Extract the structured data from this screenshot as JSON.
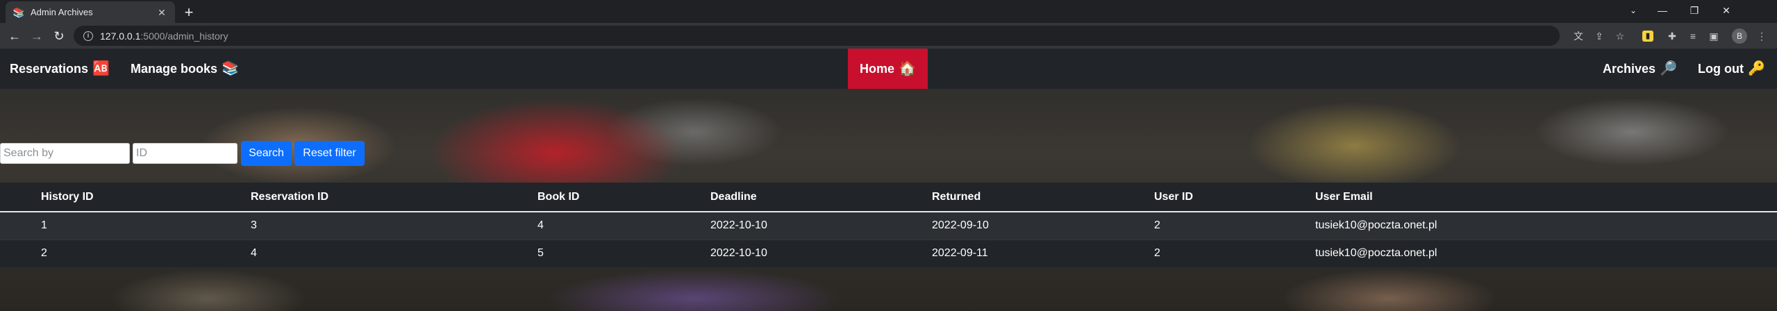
{
  "browser": {
    "tab_title": "Admin Archives",
    "tab_favicon": "📚",
    "url_host": "127.0.0.1",
    "url_path": ":5000/admin_history",
    "profile_initial": "B"
  },
  "nav": {
    "reservations": "Reservations",
    "reservations_emoji": "🆎",
    "manage_books": "Manage books",
    "manage_books_emoji": "📚",
    "home": "Home",
    "home_emoji": "🏠",
    "archives": "Archives",
    "archives_emoji": "🔎",
    "logout": "Log out",
    "logout_emoji": "🔑"
  },
  "filters": {
    "search_placeholder": "Search by",
    "id_placeholder": "ID",
    "search_button": "Search",
    "reset_button": "Reset filter"
  },
  "table": {
    "columns": [
      "History ID",
      "Reservation ID",
      "Book ID",
      "Deadline",
      "Returned",
      "User ID",
      "User Email"
    ],
    "rows": [
      [
        "1",
        "3",
        "4",
        "2022-10-10",
        "2022-09-10",
        "2",
        "tusiek10@poczta.onet.pl"
      ],
      [
        "2",
        "4",
        "5",
        "2022-10-10",
        "2022-09-11",
        "2",
        "tusiek10@poczta.onet.pl"
      ]
    ]
  },
  "colors": {
    "navbar": "#212529",
    "home_active": "#c8102e",
    "button_primary": "#0d6efd"
  }
}
